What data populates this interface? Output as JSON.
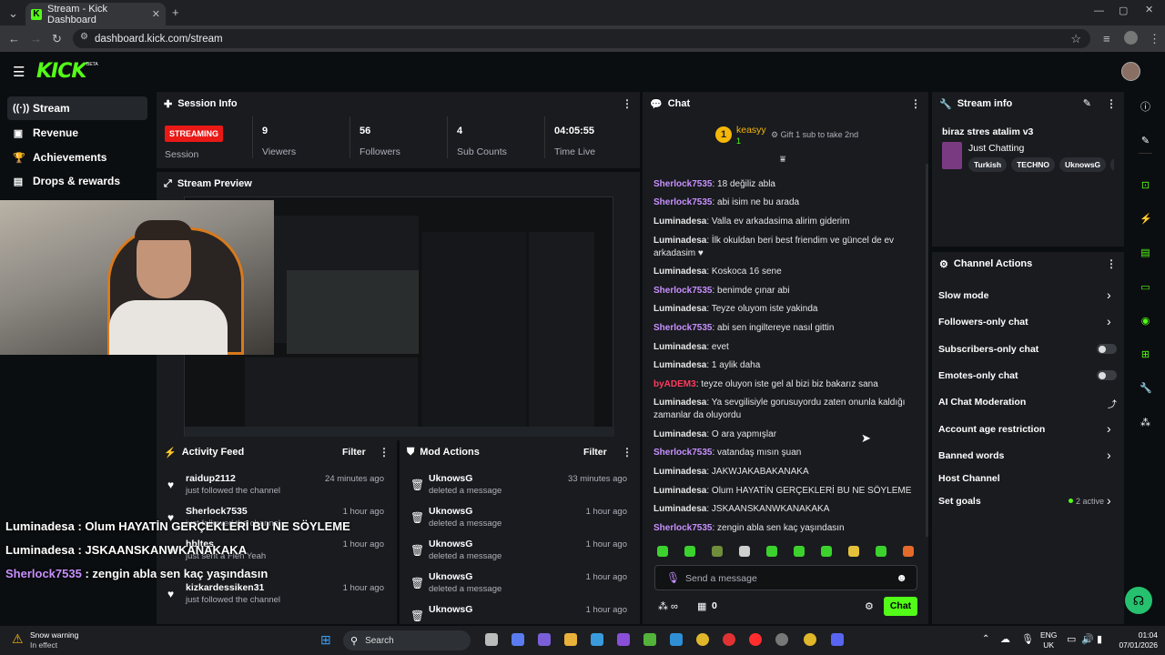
{
  "browser": {
    "tab_title": "Stream - Kick Dashboard",
    "url": "dashboard.kick.com/stream"
  },
  "app": {
    "logo": "KICK",
    "beta": "BETA"
  },
  "sidebar": {
    "items": [
      {
        "label": "Stream",
        "icon": "broadcast-icon"
      },
      {
        "label": "Revenue",
        "icon": "money-icon"
      },
      {
        "label": "Achievements",
        "icon": "trophy-icon"
      },
      {
        "label": "Drops & rewards",
        "icon": "gift-icon"
      }
    ]
  },
  "session": {
    "title": "Session Info",
    "status": "STREAMING",
    "status_label": "Session",
    "stats": [
      {
        "value": "9",
        "label": "Viewers"
      },
      {
        "value": "56",
        "label": "Followers"
      },
      {
        "value": "4",
        "label": "Sub Counts"
      },
      {
        "value": "04:05:55",
        "label": "Time Live"
      }
    ]
  },
  "preview": {
    "title": "Stream Preview"
  },
  "activity": {
    "title": "Activity Feed",
    "filter": "Filter",
    "rows": [
      {
        "name": "raidup2112",
        "sub": "just followed the channel",
        "time": "24 minutes ago"
      },
      {
        "name": "Sherlock7535",
        "sub": "just followed the channel",
        "time": "1 hour ago"
      },
      {
        "name": "hbltes",
        "sub": "just sent a Fleh Yeah",
        "time": "1 hour ago"
      },
      {
        "name": "kizkardessiken31",
        "sub": "just followed the channel",
        "time": "1 hour ago"
      }
    ]
  },
  "mod": {
    "title": "Mod Actions",
    "filter": "Filter",
    "rows": [
      {
        "name": "UknowsG",
        "sub": "deleted a message",
        "time": "33 minutes ago"
      },
      {
        "name": "UknowsG",
        "sub": "deleted a message",
        "time": "1 hour ago"
      },
      {
        "name": "UknowsG",
        "sub": "deleted a message",
        "time": "1 hour ago"
      },
      {
        "name": "UknowsG",
        "sub": "deleted a message",
        "time": "1 hour ago"
      },
      {
        "name": "UknowsG",
        "sub": "",
        "time": "1 hour ago"
      }
    ]
  },
  "chat": {
    "title": "Chat",
    "leader_rank": "1",
    "leader_name": "keasyy",
    "leader_count": "1",
    "gift_text": "Gift 1 sub to take 2nd",
    "messages": [
      {
        "user": "Sherlock7535",
        "text": ": 18 değiliz abla"
      },
      {
        "user": "Sherlock7535",
        "text": ": abi isim ne bu arada"
      },
      {
        "user": "Luminadesa",
        "text": ": Valla ev arkadasima alirim giderim"
      },
      {
        "user": "Luminadesa",
        "text": ": İlk okuldan beri best friendim ve güncel de ev arkadasim ♥"
      },
      {
        "user": "Luminadesa",
        "text": ": Koskoca 16 sene"
      },
      {
        "user": "Sherlock7535",
        "text": ": benimde çınar abi"
      },
      {
        "user": "Luminadesa",
        "text": ": Teyze oluyom iste yakinda"
      },
      {
        "user": "Sherlock7535",
        "text": ": abi sen ingiltereye nasıl gittin"
      },
      {
        "user": "Luminadesa",
        "text": ": evet"
      },
      {
        "user": "Luminadesa",
        "text": ": 1 aylik daha"
      },
      {
        "user": "byADEM3",
        "text": ": teyze oluyon iste gel al bizi biz bakarız sana"
      },
      {
        "user": "Luminadesa",
        "text": ": Ya sevgilisiyle gorusuyordu zaten onunla kaldığı zamanlar da oluyordu"
      },
      {
        "user": "Luminadesa",
        "text": ": O ara yapmışlar"
      },
      {
        "user": "Sherlock7535",
        "text": ": vatandaş mısın şuan"
      },
      {
        "user": "Luminadesa",
        "text": ": JAKWJAKABAKANAKA"
      },
      {
        "user": "Luminadesa",
        "text": ": Olum HAYATİN GERÇEKLERİ BU NE SÖYLEME"
      },
      {
        "user": "Luminadesa",
        "text": ": JSKAANSKANWKANAKAKA"
      },
      {
        "user": "Sherlock7535",
        "text": ": zengin abla sen kaç yaşındasın"
      }
    ],
    "input_placeholder": "Send a message",
    "points": "0",
    "send": "Chat"
  },
  "stream_info": {
    "title": "Stream info",
    "stream_title": "biraz stres atalim v3",
    "category": "Just Chatting",
    "tags": [
      "Turkish",
      "TECHNO",
      "UknowsG",
      "re"
    ]
  },
  "channel_actions": {
    "title": "Channel Actions",
    "items": [
      {
        "label": "Slow mode",
        "control": "chevron"
      },
      {
        "label": "Followers-only chat",
        "control": "chevron"
      },
      {
        "label": "Subscribers-only chat",
        "control": "toggle"
      },
      {
        "label": "Emotes-only chat",
        "control": "toggle"
      },
      {
        "label": "AI Chat Moderation",
        "control": "external"
      },
      {
        "label": "Account age restriction",
        "control": "chevron"
      },
      {
        "label": "Banned words",
        "control": "chevron"
      },
      {
        "label": "Host Channel",
        "control": "none"
      },
      {
        "label": "Set goals",
        "control": "chevron"
      }
    ],
    "goals_status": "2 active"
  },
  "overlay": [
    {
      "user": "Luminadesa",
      "text": " : Olum HAYATİN GERÇEKLERİ BU NE SÖYLEME"
    },
    {
      "user": "Luminadesa",
      "text": " : JSKAANSKANWKANAKAKA"
    },
    {
      "user": "Sherlock7535",
      "text": " : zengin abla sen kaç yaşındasın"
    }
  ],
  "taskbar": {
    "weather_title": "Snow warning",
    "weather_sub": "In effect",
    "search": "Search",
    "lang": "ENG",
    "region": "UK",
    "time": "01:04",
    "date": "07/01/2026"
  },
  "colors": {
    "accent": "#53fc18",
    "live": "#e91916",
    "panel": "#191b1f"
  }
}
